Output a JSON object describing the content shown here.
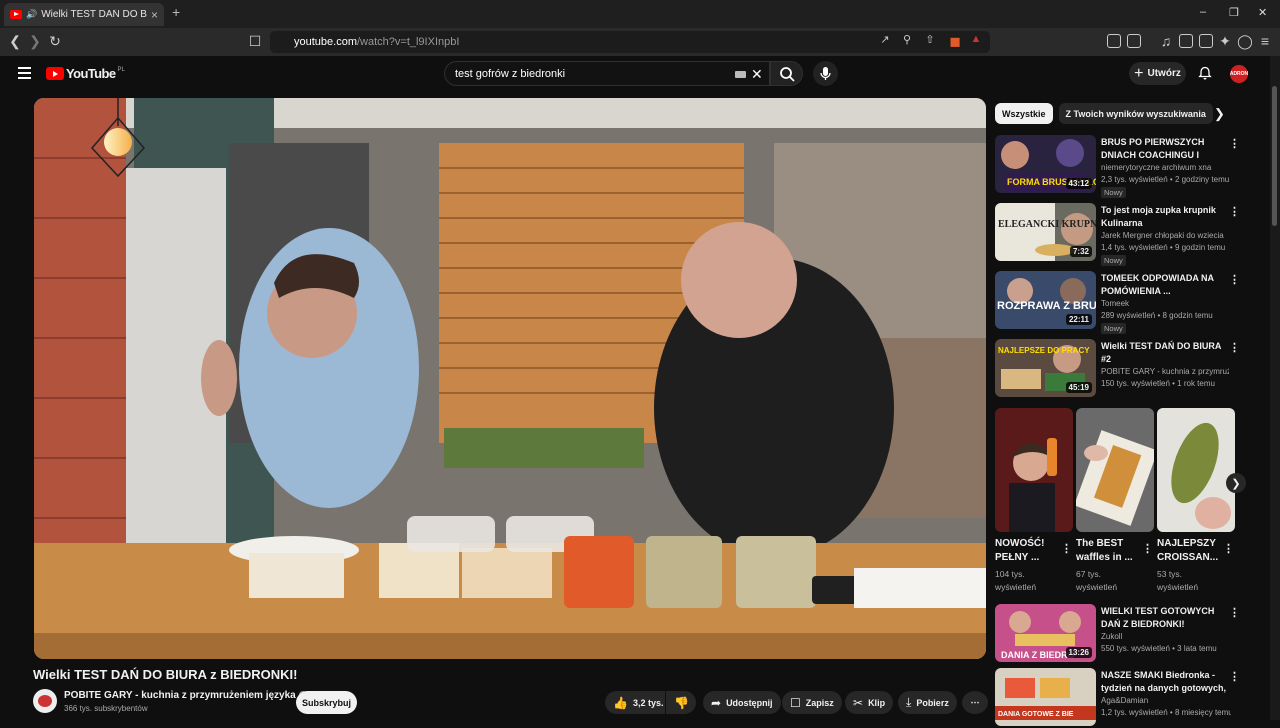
{
  "browser": {
    "tab_title": "Wielki TEST DAŃ DO BIURA z",
    "tab_close": "×",
    "new_tab": "+",
    "url_host": "youtube.com",
    "url_path": "/watch?v=t_l9IXInpbI"
  },
  "header": {
    "logo_text": "YouTube",
    "logo_region": "PL",
    "search_value": "test gofrów z biedronki",
    "create_label": "Utwórz",
    "avatar_text": "ADRON"
  },
  "video": {
    "title": "Wielki TEST DAŃ DO BIURA z BIEDRONKI!",
    "channel": "POBITE GARY - kuchnia z przymrużeniem języka",
    "subscribers": "366 tys. subskrybentów",
    "subscribe_label": "Subskrybuj",
    "likes": "3,2 tys.",
    "share_label": "Udostępnij",
    "save_label": "Zapisz",
    "clip_label": "Klip",
    "download_label": "Pobierz"
  },
  "sidebar": {
    "chips": [
      "Wszystkie",
      "Z Twoich wyników wyszukiwania"
    ],
    "videos": [
      {
        "title": "BRUS PO PIERWSZYCH DNIACH COACHINGU I TEMAT ...",
        "channel": "niemerytoryczne archiwum xna",
        "meta": "2,3 tys. wyświetleń • 2 godziny temu",
        "badge": "Nowy",
        "duration": "43:12",
        "thumb_color": "#5a3a6a"
      },
      {
        "title": "To jest moja zupka krupnik Kulinarna",
        "channel": "Jarek Mergner chłopaki do wziecia",
        "meta": "1,4 tys. wyświetleń • 9 godzin temu",
        "badge": "Nowy",
        "duration": "7:32",
        "thumb_color": "#4a5a3a"
      },
      {
        "title": "TOMEEK ODPOWIADA NA POMÓWIENIA ...",
        "channel": "Tomeek",
        "meta": "289 wyświetleń • 8 godzin temu",
        "badge": "Nowy",
        "duration": "22:11",
        "thumb_color": "#3a4a6a"
      },
      {
        "title": "Wielki TEST DAŃ DO BIURA #2",
        "channel": "POBITE GARY - kuchnia z przymrużenie...",
        "meta": "150 tys. wyświetleń • 1 rok temu",
        "badge": "",
        "duration": "45:19",
        "thumb_color": "#6a4a3a"
      },
      {
        "title": "WIELKI TEST GOTOWYCH DAŃ Z BIEDRONKI!",
        "channel": "Zukoll",
        "meta": "550 tys. wyświetleń • 3 lata temu",
        "badge": "",
        "duration": "13:26",
        "thumb_color": "#6a3a5a"
      },
      {
        "title": "NASZE SMAKI Biedronka - tydzień na danych gotowych, ...",
        "channel": "Aga&Damian",
        "meta": "1,2 tys. wyświetleń • 8 miesięcy temu",
        "badge": "",
        "duration": "",
        "thumb_color": "#7a5a3a"
      }
    ],
    "shorts": [
      {
        "title": "NOWOŚĆ! PEŁNY ...",
        "views": "104 tys. wyświetleń"
      },
      {
        "title": "The BEST waffles in ...",
        "views": "67 tys. wyświetleń"
      },
      {
        "title": "NAJLEPSZY CROISSAN...",
        "views": "53 tys. wyświetleń"
      }
    ],
    "thumb_texts": {
      "v1": "FORMA BRUSA W LOLU BE",
      "v2": "ELEGANCKI KRUPNIK",
      "v3": "ROZPRAWA Z BRUSEM",
      "v4": "NAJLEPSZE DO PRACY",
      "v5": "DANIA Z BIEDRO",
      "v6": "DANIA GOTOWE Z BIE"
    }
  }
}
